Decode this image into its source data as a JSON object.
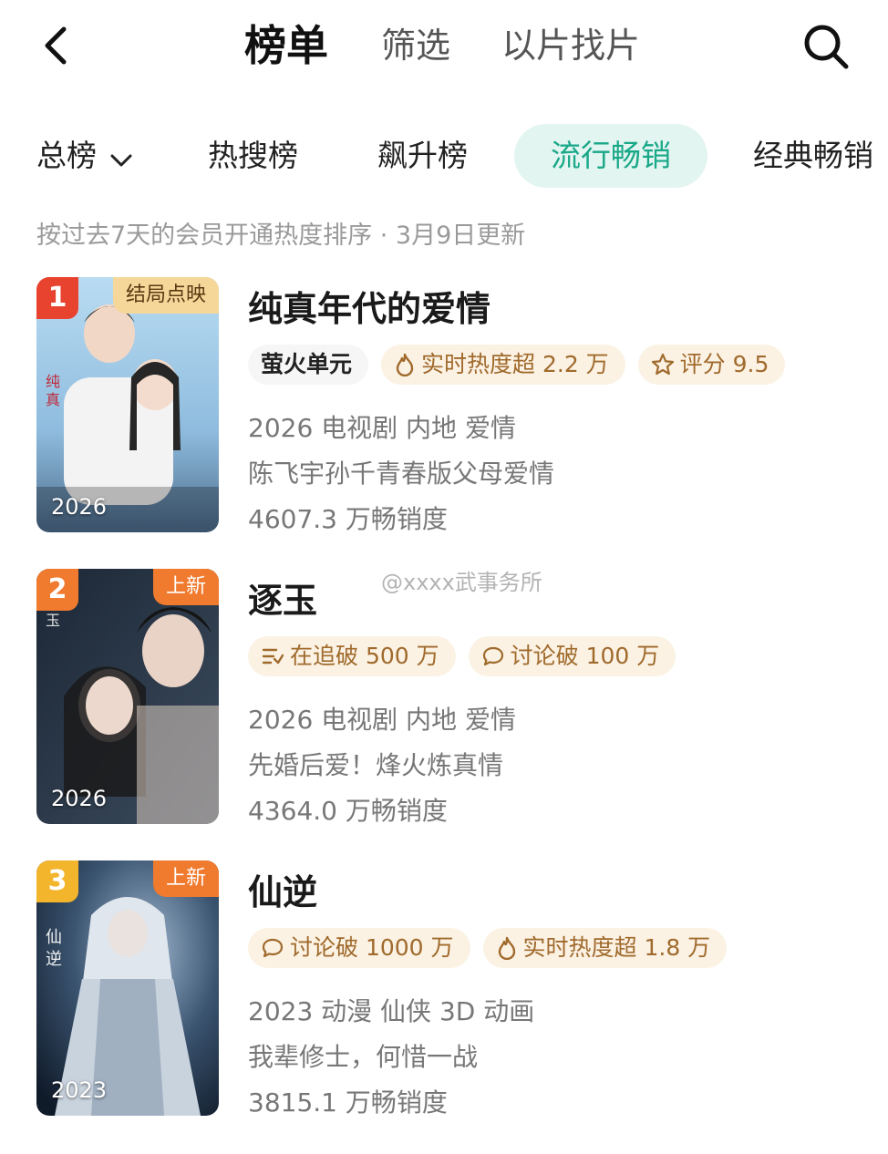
{
  "header": {
    "tabs": [
      {
        "label": "榜单"
      },
      {
        "label": "筛选"
      },
      {
        "label": "以片找片"
      }
    ]
  },
  "subtabs": [
    {
      "label": "总榜"
    },
    {
      "label": "热搜榜"
    },
    {
      "label": "飙升榜"
    },
    {
      "label": "流行畅销"
    },
    {
      "label": "经典畅销"
    }
  ],
  "update_note": "按过去7天的会员开通热度排序 · 3月9日更新",
  "watermark": "@xxxx武事务所",
  "items": [
    {
      "rank": "1",
      "corner": "结局点映",
      "year": "2026",
      "title": "纯真年代的爱情",
      "tags": [
        "萤火单元",
        "实时热度超 2.2 万",
        "评分 9.5"
      ],
      "info": "2026 电视剧 内地 爱情",
      "desc": "陈飞宇孙千青春版父母爱情",
      "sales": "4607.3 万畅销度"
    },
    {
      "rank": "2",
      "corner": "上新",
      "year": "2026",
      "title": "逐玉",
      "tags": [
        "在追破 500 万",
        "讨论破 100 万"
      ],
      "info": "2026 电视剧 内地 爱情",
      "desc": "先婚后爱！烽火炼真情",
      "sales": "4364.0 万畅销度"
    },
    {
      "rank": "3",
      "corner": "上新",
      "year": "2023",
      "title": "仙逆",
      "tags": [
        "讨论破 1000 万",
        "实时热度超 1.8 万"
      ],
      "info": "2023 动漫 仙侠 3D 动画",
      "desc": "我辈修士，何惜一战",
      "sales": "3815.1 万畅销度"
    }
  ],
  "colors": {
    "accent": "#19a888",
    "rank_1": "#e8432f",
    "rank_2": "#f07a2e",
    "rank_3": "#f3b52c",
    "tag_text": "#a06a2c",
    "tag_bg": "#fbf2e4"
  }
}
